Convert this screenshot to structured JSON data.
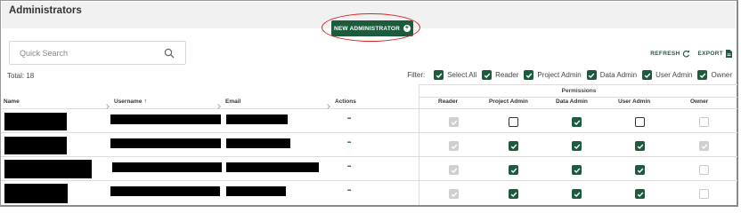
{
  "page": {
    "title": "Administrators",
    "new_button_label": "NEW ADMINISTRATOR",
    "search_placeholder": "Quick Search",
    "refresh_label": "REFRESH",
    "export_label": "EXPORT",
    "total_label": "Total: 18",
    "accent_color": "#1d5b3f",
    "highlight_color": "#d9231f"
  },
  "filter": {
    "label": "Filter:",
    "items": [
      {
        "label": "Select All",
        "checked": true
      },
      {
        "label": "Reader",
        "checked": true
      },
      {
        "label": "Project Admin",
        "checked": true
      },
      {
        "label": "Data Admin",
        "checked": true
      },
      {
        "label": "User Admin",
        "checked": true
      },
      {
        "label": "Owner",
        "checked": true
      }
    ]
  },
  "table": {
    "permissions_group": "Permissions",
    "columns": {
      "name": "Name",
      "username": "Username",
      "email": "Email",
      "actions": "Actions",
      "reader": "Reader",
      "project_admin": "Project Admin",
      "data_admin": "Data Admin",
      "user_admin": "User Admin",
      "owner": "Owner"
    },
    "rows": [
      {
        "reader": "disabled-checked",
        "project_admin": "unchecked",
        "data_admin": "checked",
        "user_admin": "unchecked",
        "owner": "disabled-unchecked"
      },
      {
        "reader": "disabled-checked",
        "project_admin": "checked",
        "data_admin": "checked",
        "user_admin": "checked",
        "owner": "disabled-checked"
      },
      {
        "reader": "disabled-checked",
        "project_admin": "checked",
        "data_admin": "checked",
        "user_admin": "checked",
        "owner": "disabled-unchecked"
      },
      {
        "reader": "disabled-checked",
        "project_admin": "checked",
        "data_admin": "checked",
        "user_admin": "checked",
        "owner": "disabled-unchecked"
      }
    ]
  }
}
